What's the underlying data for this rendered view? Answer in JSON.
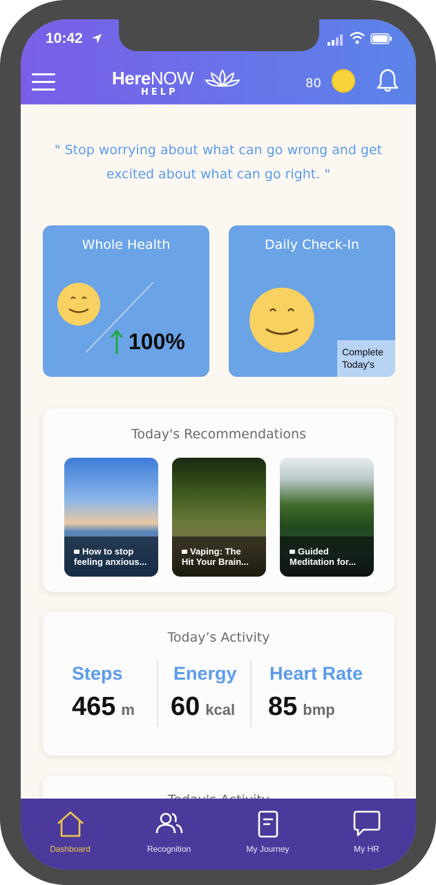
{
  "status_bar": {
    "time": "10:42"
  },
  "header": {
    "logo_main_bold": "Here",
    "logo_main_light": "NOW",
    "logo_sub": "HELP",
    "points": "80",
    "coin_color": "#f7d43c"
  },
  "quote": "\" Stop worrying about what can go wrong and get excited about what can go right. \"",
  "whole_health": {
    "title": "Whole Health",
    "percent": "100%",
    "trend": "up"
  },
  "daily_checkin": {
    "title": "Daily Check-In",
    "cta_line1": "Complete",
    "cta_line2": "Today's"
  },
  "recommendations": {
    "title": "Today's Recommendations",
    "items": [
      {
        "line1": "How to stop",
        "line2": "feeling anxious..."
      },
      {
        "line1": "Vaping: The",
        "line2": "Hit Your Brain..."
      },
      {
        "line1": "Guided",
        "line2": "Meditation for..."
      }
    ]
  },
  "activity": {
    "title": "Today’s Activity",
    "stats": [
      {
        "label": "Steps",
        "value": "465",
        "unit": "m"
      },
      {
        "label": "Energy",
        "value": "60",
        "unit": "kcal"
      },
      {
        "label": "Heart Rate",
        "value": "85",
        "unit": "bmp"
      }
    ]
  },
  "activity2": {
    "title": "Today's Activity"
  },
  "tabbar": {
    "tabs": [
      {
        "label": "Dashboard",
        "icon": "home-icon",
        "active": true
      },
      {
        "label": "Recognition",
        "icon": "people-icon",
        "active": false
      },
      {
        "label": "My Journey",
        "icon": "journal-icon",
        "active": false
      },
      {
        "label": "My HR",
        "icon": "chat-icon",
        "active": false
      }
    ]
  },
  "colors": {
    "accent": "#5b9cea",
    "card_blue": "#6aa3e6",
    "tabbar": "#4b3a9c",
    "active_tab": "#f0c44a"
  }
}
